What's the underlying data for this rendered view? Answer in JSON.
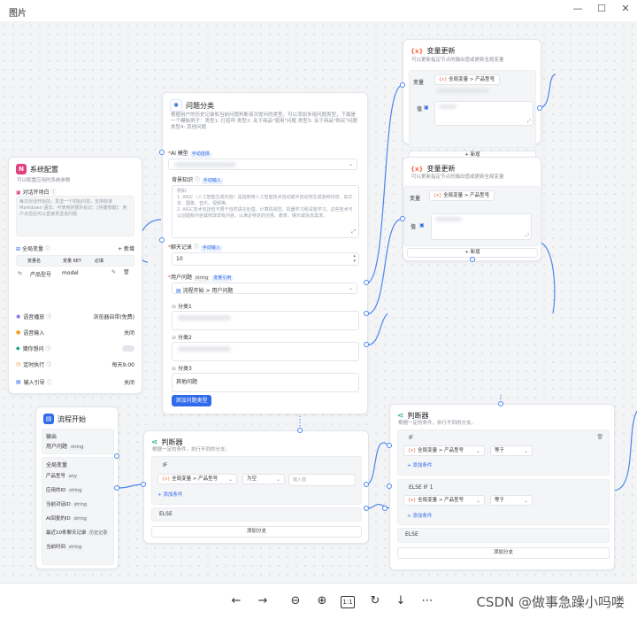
{
  "window": {
    "title": "图片"
  },
  "sys": {
    "title": "系统配置",
    "desc": "可以配置应用的系统参数",
    "opener_label": "对话开场白",
    "opener_text": "每次对话开始前，发送一个初始内容。支持标准 Markdown 语法，可使用的额外标记：[快捷按键]：用户点击后可以直接发送该问题",
    "globals_label": "全局变量",
    "add": "+ 新增",
    "col_name": "变量名",
    "col_key": "变量 KEY",
    "col_req": "必填",
    "var_name": "产品型号",
    "var_key": "model",
    "voice_label": "语音播放",
    "voice_value": "浏览器自带(免费)",
    "asr_label": "语音输入",
    "asr_value": "关闭",
    "guide_label": "猜你想问",
    "timer_label": "定时执行",
    "timer_value": "每天9:00",
    "input_label": "输入引导",
    "input_value": "关闭"
  },
  "start": {
    "title": "流程开始",
    "out_label": "输出",
    "out_var": "用户问题",
    "out_type": "string",
    "globals_label": "全局变量",
    "vars": [
      {
        "name": "产品型号",
        "type": "any"
      },
      {
        "name": "应用的ID",
        "type": "string"
      },
      {
        "name": "当前对话ID",
        "type": "string"
      },
      {
        "name": "AI回复的ID",
        "type": "string"
      },
      {
        "name": "最近10条聊天记录",
        "type": "历史记录"
      },
      {
        "name": "当前时间",
        "type": "string"
      }
    ]
  },
  "classify": {
    "title": "问题分类",
    "desc": "根据用户的历史记录和当前问题判断该次提问的类型。可以添加多组问题类型，下面是一个模板例子：类型1: 打招呼 类型2: 关于商品\"使用\"问题 类型3: 关于商品\"购买\"问题 类型4: 其他问题",
    "model_label": "AI 模型",
    "model_mode": "手动选择",
    "bg_label": "背景知识",
    "bg_mode": "手动输入",
    "bg_text": "例如:\n1. AIGC（人工智能生成内容）是指使用人工智能技术自动或半自动地生成各种内容，如文本、图像、音乐、视频等。\n2. AIGC技术包括但不限于自然语言处理、计算机视觉、机器学习和深度学习。这些技术可以创建新内容或修改现有内容，以满足特定的创意、教育、娱乐或信息需求。",
    "history_label": "聊天记录",
    "history_mode": "手动输入",
    "history_value": "10",
    "question_label": "用户问题",
    "question_type": "string",
    "question_mode": "变量引用",
    "question_ref": "流程开始 > 用户问题",
    "class1": "分类1",
    "class2": "分类2",
    "class3": "分类3",
    "class3_value": "其他问题",
    "add_type": "添加问题类型"
  },
  "update1": {
    "title": "变量更新",
    "desc": "可以更新指定节点的输出值或更新全局变量",
    "var_label": "变量",
    "var_ref": "全局变量 > 产品型号",
    "add": "+ 新增"
  },
  "update2": {
    "title": "变量更新",
    "desc": "可以更新指定节点的输出值或更新全局变量",
    "var_label": "变量",
    "var_ref": "全局变量 > 产品型号",
    "value_label": "值",
    "add": "+ 新增"
  },
  "judge1": {
    "title": "判断器",
    "desc": "根据一定的条件，执行不同的分支。",
    "if": "IF",
    "ref": "全局变量 > 产品型号",
    "op": "为空",
    "input_ph": "输入值",
    "add_cond": "添加条件",
    "else": "ELSE",
    "add_branch": "添加分支"
  },
  "judge2": {
    "title": "判断器",
    "desc": "根据一定的条件，执行不同的分支。",
    "if": "IF",
    "ref1": "全局变量 > 产品型号",
    "op1": "等于",
    "add_cond": "添加条件",
    "elseif": "ELSE IF 1",
    "ref2": "全局变量 > 产品型号",
    "op2": "等于",
    "else": "ELSE",
    "add_branch": "添加分支"
  },
  "toolbar": {
    "ratio": "1:1",
    "watermark": "CSDN @做事急躁小吗喽"
  },
  "colors": {
    "accent": "#2f6bea",
    "wire": "#4c86f0",
    "var_icon": "#f56b4a"
  }
}
